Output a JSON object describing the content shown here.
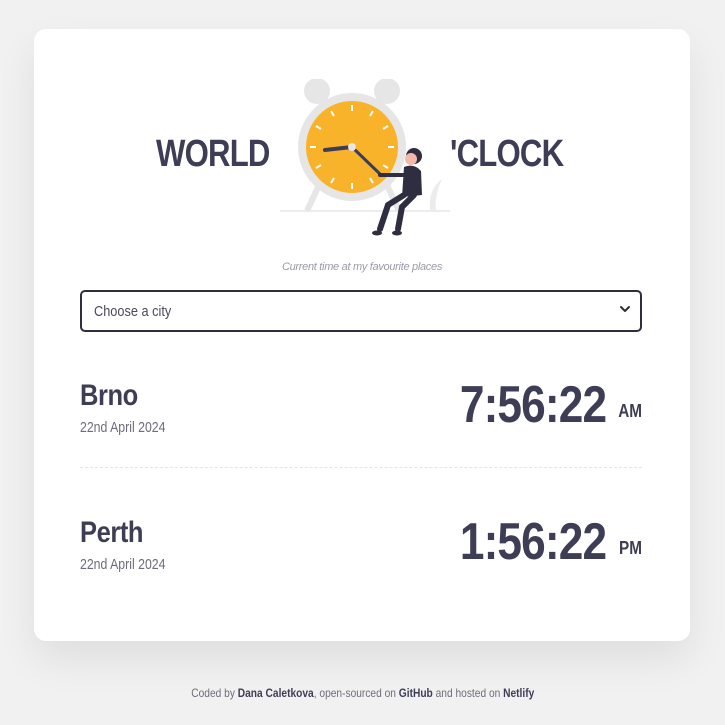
{
  "header": {
    "title_left": "WORLD",
    "title_right": "'CLOCK",
    "subtitle": "Current time at my favourite places"
  },
  "city_select": {
    "selected_label": "Choose a city",
    "icon": "chevron-down-icon"
  },
  "cities": [
    {
      "name": "Brno",
      "date": "22nd April 2024",
      "time": "7:56:22",
      "ampm": "AM"
    },
    {
      "name": "Perth",
      "date": "22nd April 2024",
      "time": "1:56:22",
      "ampm": "PM"
    }
  ],
  "footer": {
    "prefix": "Coded by ",
    "author": "Dana Caletkova",
    "mid1": ", open-sourced on ",
    "github": "GitHub",
    "mid2": " and hosted on ",
    "netlify": "Netlify"
  },
  "colors": {
    "text_dark": "#3e3d56",
    "clock_face": "#f9b32a",
    "background": "#f1f1f1"
  }
}
